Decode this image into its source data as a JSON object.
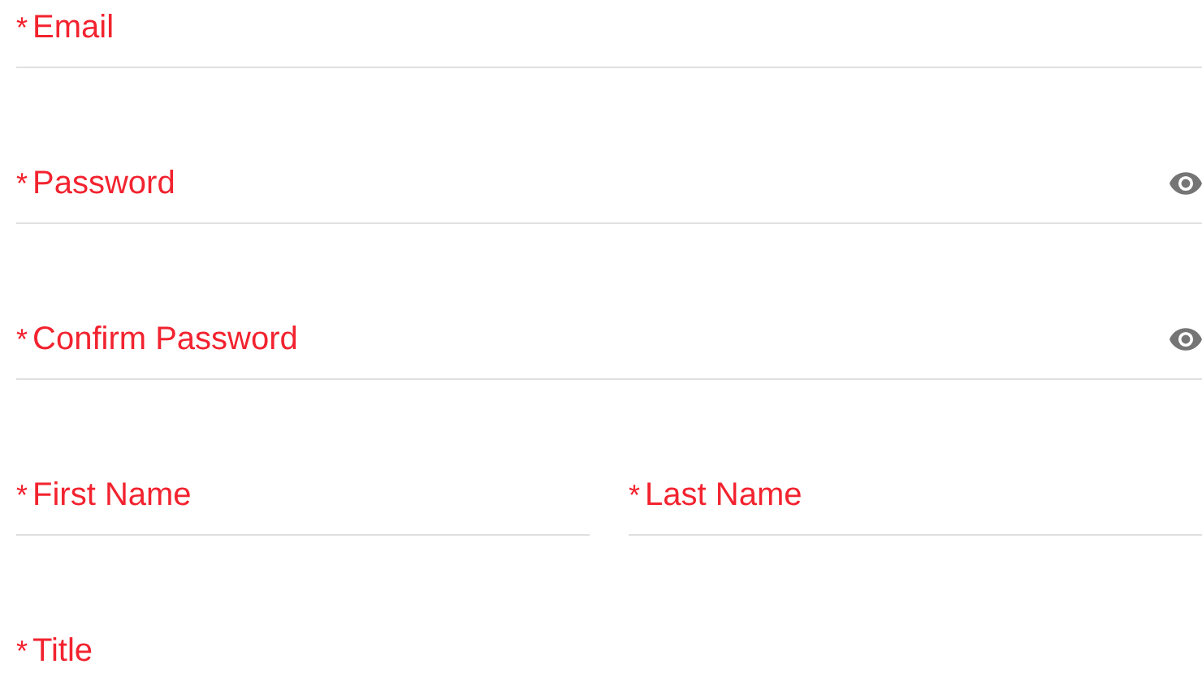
{
  "rows": [
    {
      "fields": [
        {
          "label": "Email",
          "required_mark": "*",
          "kind": "text"
        }
      ]
    },
    {
      "fields": [
        {
          "label": "Password",
          "required_mark": "*",
          "kind": "password"
        }
      ]
    },
    {
      "fields": [
        {
          "label": "Confirm Password",
          "required_mark": "*",
          "kind": "password"
        }
      ]
    },
    {
      "fields": [
        {
          "label": "First Name",
          "required_mark": "*",
          "kind": "text"
        },
        {
          "label": "Last Name",
          "required_mark": "*",
          "kind": "text"
        }
      ]
    },
    {
      "fields": [
        {
          "label": "Title",
          "required_mark": "*",
          "kind": "text"
        }
      ]
    }
  ]
}
